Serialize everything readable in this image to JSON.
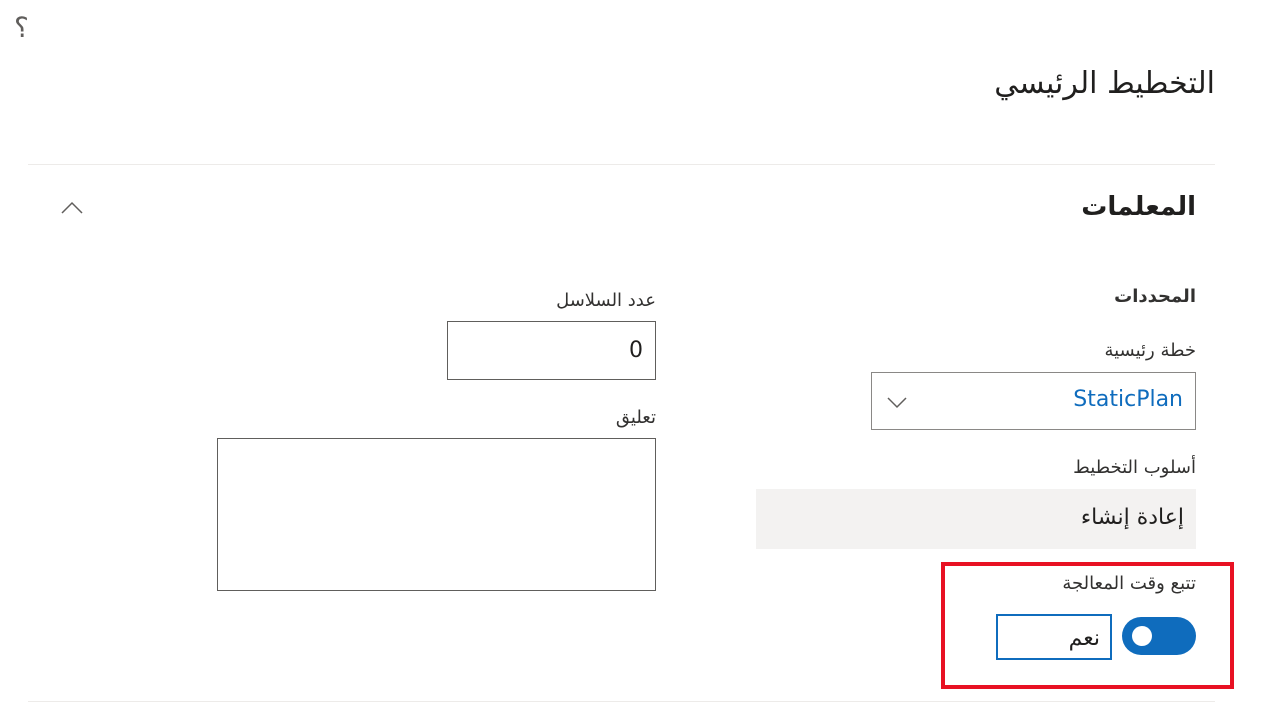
{
  "page": {
    "title": "التخطيط الرئيسي",
    "help_glyph": "؟"
  },
  "section": {
    "title": "المعلمات"
  },
  "identifiers": {
    "group_label": "المحددات",
    "master_plan": {
      "label": "خطة رئيسية",
      "value": "StaticPlan"
    },
    "planning_method": {
      "label": "أسلوب التخطيط",
      "value": "إعادة إنشاء"
    },
    "track_processing_time": {
      "label": "تتبع وقت المعالجة",
      "value_text": "نعم",
      "enabled": true
    }
  },
  "right_fields": {
    "number_of_threads": {
      "label": "عدد السلاسل",
      "value": "0"
    },
    "comment": {
      "label": "تعليق",
      "value": ""
    }
  },
  "colors": {
    "accent": "#0f6cbd",
    "highlight": "#e81123",
    "readonly_bg": "#f3f2f1"
  },
  "icons": {
    "help": "help-icon",
    "collapse": "chevron-up-icon",
    "dropdown": "chevron-down-icon"
  }
}
